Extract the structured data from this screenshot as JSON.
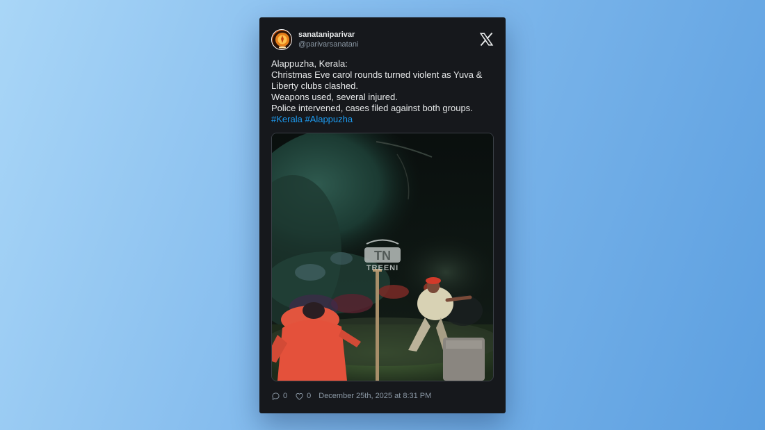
{
  "post": {
    "author": {
      "display_name": "sanataniparivar",
      "handle": "@parivarsanatani"
    },
    "text_lines": [
      "Alappuzha, Kerala:",
      "Christmas Eve carol rounds turned violent as Yuva &",
      "Liberty clubs clashed.",
      "Weapons used, several injured.",
      "Police intervened, cases filed against both groups."
    ],
    "hashtags": [
      "#Kerala",
      "#Alappuzha"
    ],
    "media": {
      "watermark_logo": "TN",
      "watermark_text": "TREENI"
    },
    "stats": {
      "replies": "0",
      "likes": "0"
    },
    "timestamp": "December 25th, 2025 at 8:31 PM"
  },
  "icons": {
    "platform": "x-logo-icon",
    "reply": "reply-bubble-icon",
    "like": "heart-icon"
  },
  "colors": {
    "card_background": "#16181c",
    "hashtag": "#1d9bf0",
    "secondary_text": "#8b98a5"
  }
}
